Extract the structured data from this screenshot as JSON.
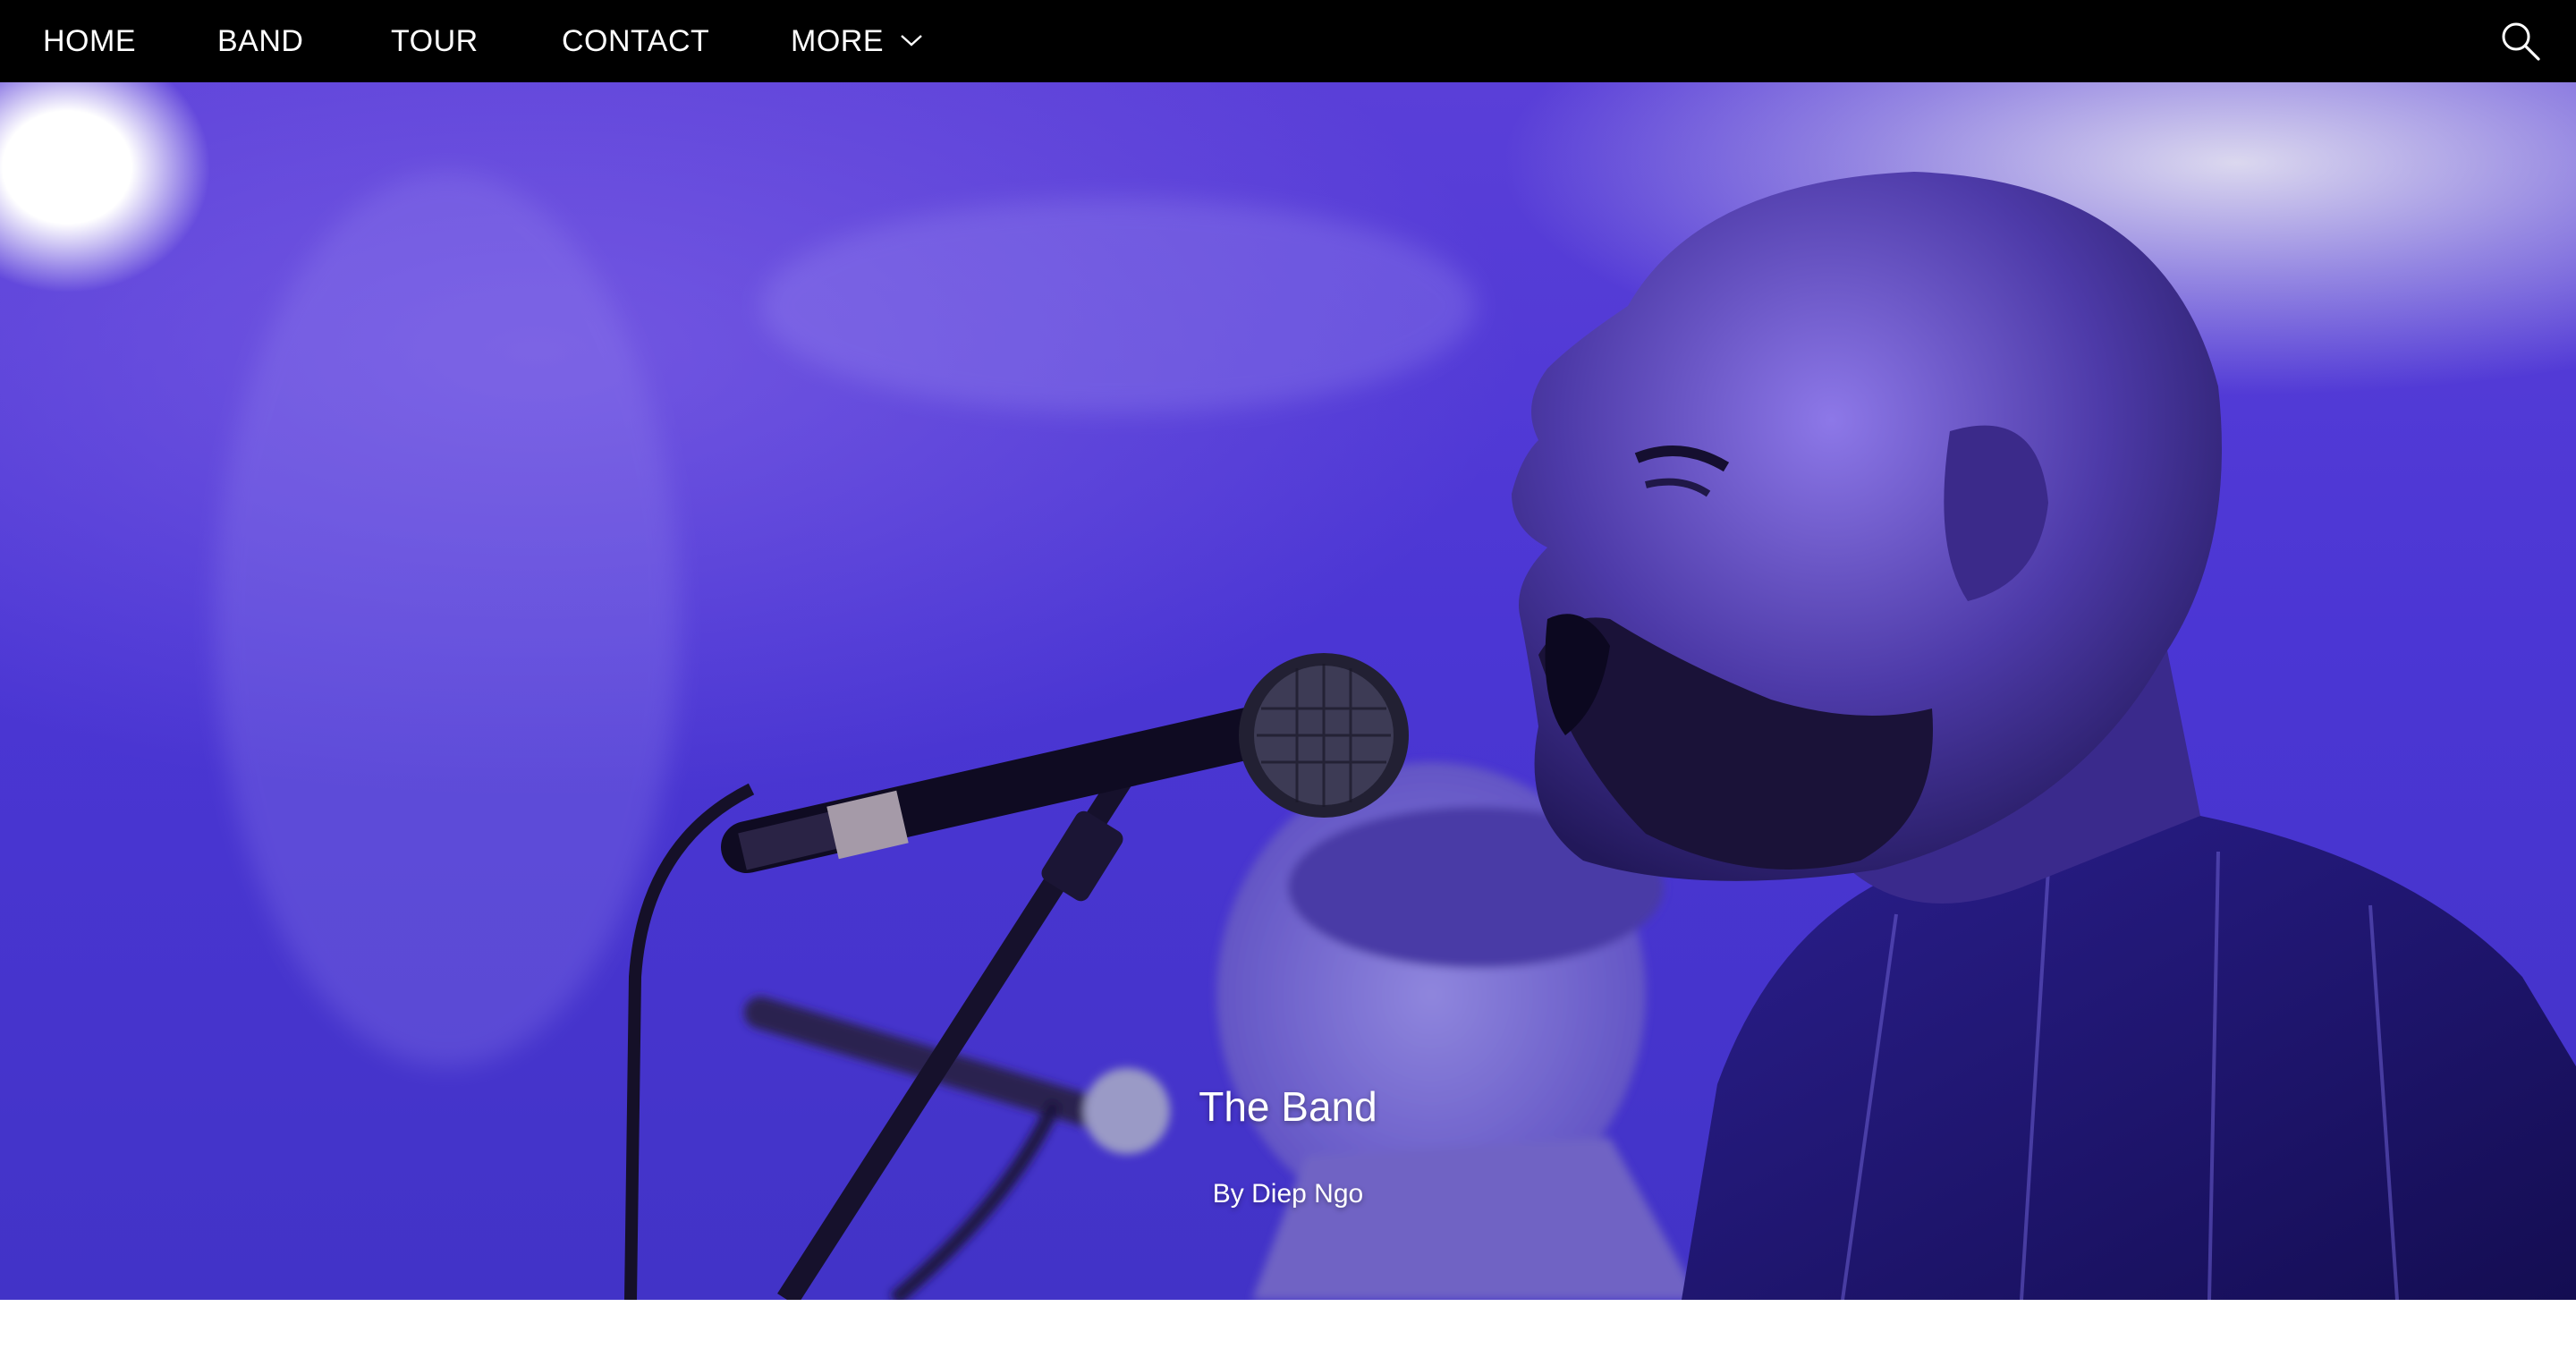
{
  "nav": {
    "items": [
      {
        "label": "HOME"
      },
      {
        "label": "BAND"
      },
      {
        "label": "TOUR"
      },
      {
        "label": "CONTACT"
      },
      {
        "label": "MORE"
      }
    ],
    "more_icon": "chevron-down-icon",
    "search_icon": "search-icon"
  },
  "hero": {
    "title": "The Band",
    "byline": "By Diep Ngo"
  },
  "colors": {
    "nav_bg": "#000000",
    "hero_purple": "#4b36d4",
    "text": "#ffffff"
  }
}
